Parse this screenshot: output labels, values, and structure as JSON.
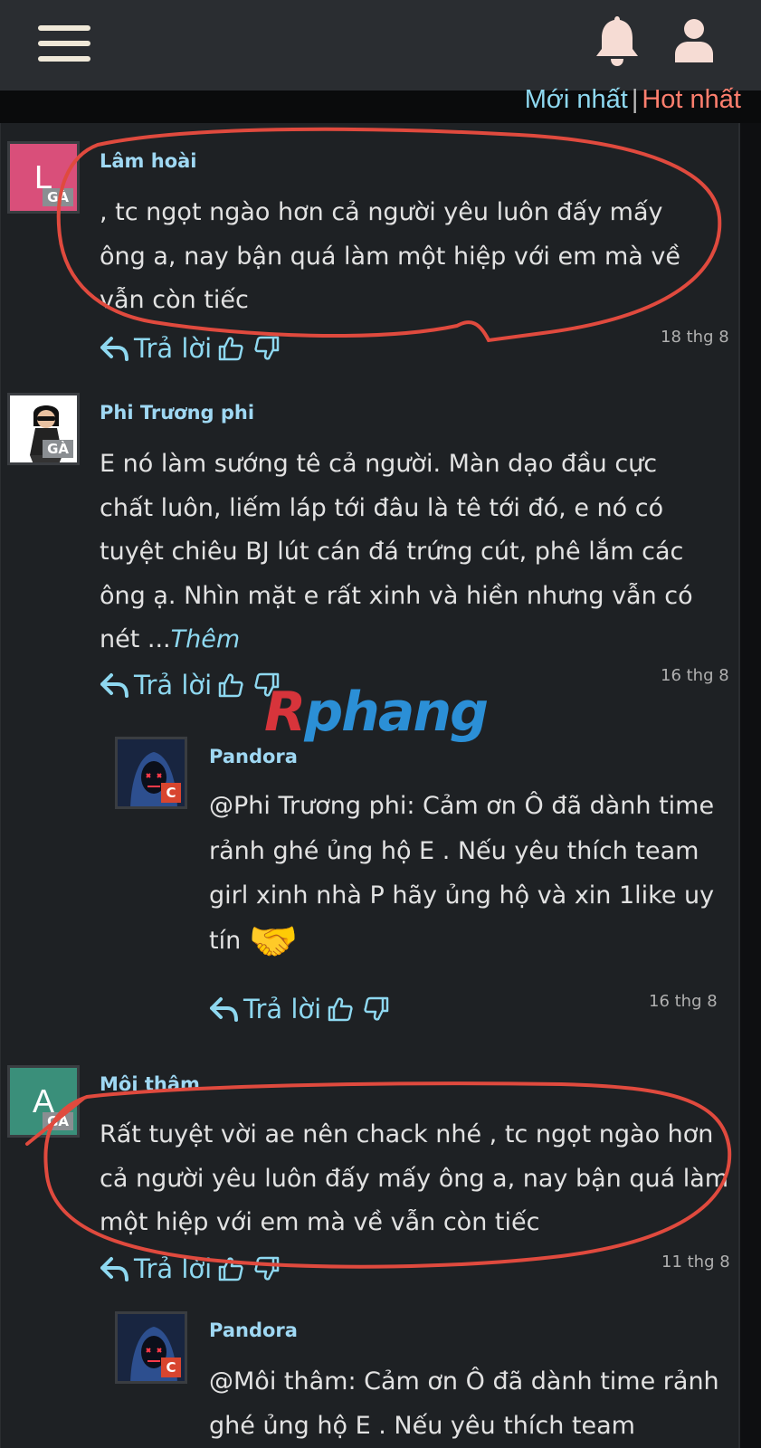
{
  "header": {
    "menu_icon": "hamburger-menu-icon",
    "notifications_icon": "bell-icon",
    "account_icon": "user-icon"
  },
  "sort": {
    "newest": "Mới nhất",
    "separator": "|",
    "hot": "Hot nhất",
    "newest_color": "#8ed8f0",
    "hot_color": "#ff7f6e"
  },
  "labels": {
    "reply": "Trả lời",
    "more": "Thêm",
    "badge_ga": "GÀ",
    "badge_c": "C"
  },
  "watermark": {
    "first": "R",
    "rest": "phang"
  },
  "comments": [
    {
      "avatar_letter": "L",
      "avatar_color": "#d94f7a",
      "author": "Lâm hoài",
      "text": ", tc ngọt ngào hơn cả người yêu luôn đấy mấy ông a, nay bận quá làm một hiệp với em mà về vẫn còn tiếc",
      "date": "18 thg 8"
    },
    {
      "avatar_letter": "",
      "author": "Phi Trương phi",
      "text": "E nó làm sướng tê cả người. Màn dạo đầu cực chất luôn, liếm láp tới đâu là tê tới đó, e nó có tuyệt chiêu BJ lút cán đá trứng cút, phê lắm các ông ạ. Nhìn mặt e rất xinh và hiền nhưng vẫn có nét ...",
      "date": "16 thg 8",
      "reply": {
        "author": "Pandora",
        "text": "@Phi Trương phi: Cảm ơn Ô đã dành time rảnh ghé ủng hộ E . Nếu yêu thích team girl xinh nhà P hãy ủng hộ và xin 1like uy tín",
        "emoji": "🤝",
        "date": "16 thg 8"
      }
    },
    {
      "avatar_letter": "A",
      "avatar_color": "#3a8f7a",
      "author": "Môi thâm",
      "text": "Rất tuyệt vời ae nên chack nhé , tc ngọt ngào hơn cả người yêu luôn đấy mấy ông a, nay bận quá làm một hiệp với em mà về vẫn còn tiếc",
      "date": "11 thg 8",
      "reply": {
        "author": "Pandora",
        "text": "@Môi thâm: Cảm ơn Ô đã dành time rảnh ghé ủng hộ E . Nếu yêu thích team"
      }
    }
  ]
}
